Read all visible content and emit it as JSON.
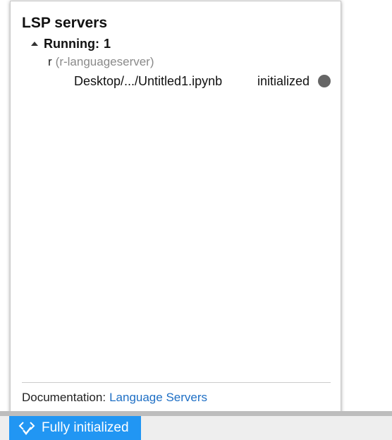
{
  "popup": {
    "title": "LSP servers",
    "running_label": "Running:",
    "running_count": "1",
    "server": {
      "name": "r",
      "description": "(r-languageserver)"
    },
    "document": {
      "path": "Desktop/.../Untitled1.ipynb",
      "status": "initialized",
      "status_icon": "status-dot-icon",
      "status_color": "#666666"
    },
    "footer": {
      "label": "Documentation:",
      "link": "Language Servers",
      "link_color": "#1e6fc5"
    }
  },
  "statusbar": {
    "lsp_status": "Fully initialized",
    "lsp_icon": "code-check-icon",
    "accent": "#2196f3"
  }
}
